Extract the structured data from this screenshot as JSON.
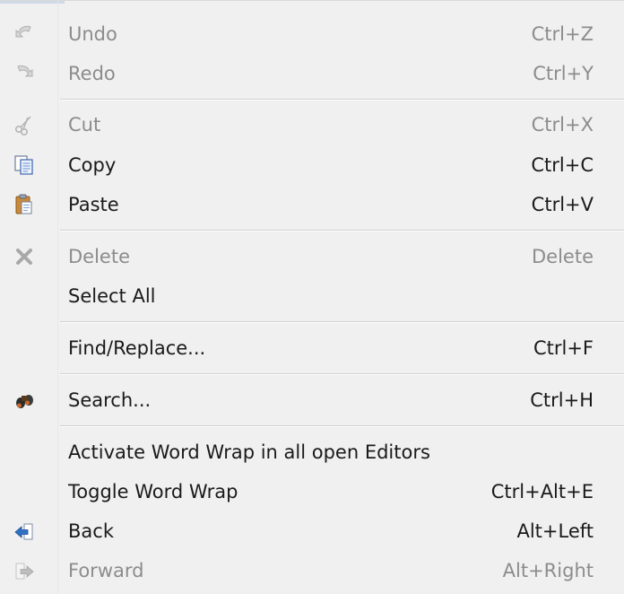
{
  "menu": {
    "items": [
      {
        "label": "Undo",
        "shortcut": "Ctrl+Z",
        "icon": "undo-icon",
        "enabled": false
      },
      {
        "label": "Redo",
        "shortcut": "Ctrl+Y",
        "icon": "redo-icon",
        "enabled": false
      },
      {
        "label": "Cut",
        "shortcut": "Ctrl+X",
        "icon": "scissors-icon",
        "enabled": false
      },
      {
        "label": "Copy",
        "shortcut": "Ctrl+C",
        "icon": "copy-icon",
        "enabled": true
      },
      {
        "label": "Paste",
        "shortcut": "Ctrl+V",
        "icon": "paste-icon",
        "enabled": true
      },
      {
        "label": "Delete",
        "shortcut": "Delete",
        "icon": "delete-x-icon",
        "enabled": false
      },
      {
        "label": "Select All",
        "shortcut": "",
        "icon": "",
        "enabled": true
      },
      {
        "label": "Find/Replace...",
        "shortcut": "Ctrl+F",
        "icon": "",
        "enabled": true
      },
      {
        "label": "Search...",
        "shortcut": "Ctrl+H",
        "icon": "binoculars-icon",
        "enabled": true
      },
      {
        "label": "Activate Word Wrap in all open Editors",
        "shortcut": "",
        "icon": "",
        "enabled": true
      },
      {
        "label": "Toggle Word Wrap",
        "shortcut": "Ctrl+Alt+E",
        "icon": "",
        "enabled": true
      },
      {
        "label": "Back",
        "shortcut": "Alt+Left",
        "icon": "back-arrow-icon",
        "enabled": true
      },
      {
        "label": "Forward",
        "shortcut": "Alt+Right",
        "icon": "forward-arrow-icon",
        "enabled": false
      }
    ]
  },
  "colors": {
    "background": "#f0f0f0",
    "text_enabled": "#1a1a1a",
    "text_disabled": "#8c8c8c",
    "separator": "#cfcfcf",
    "back_icon_blue": "#2f6fc4"
  }
}
